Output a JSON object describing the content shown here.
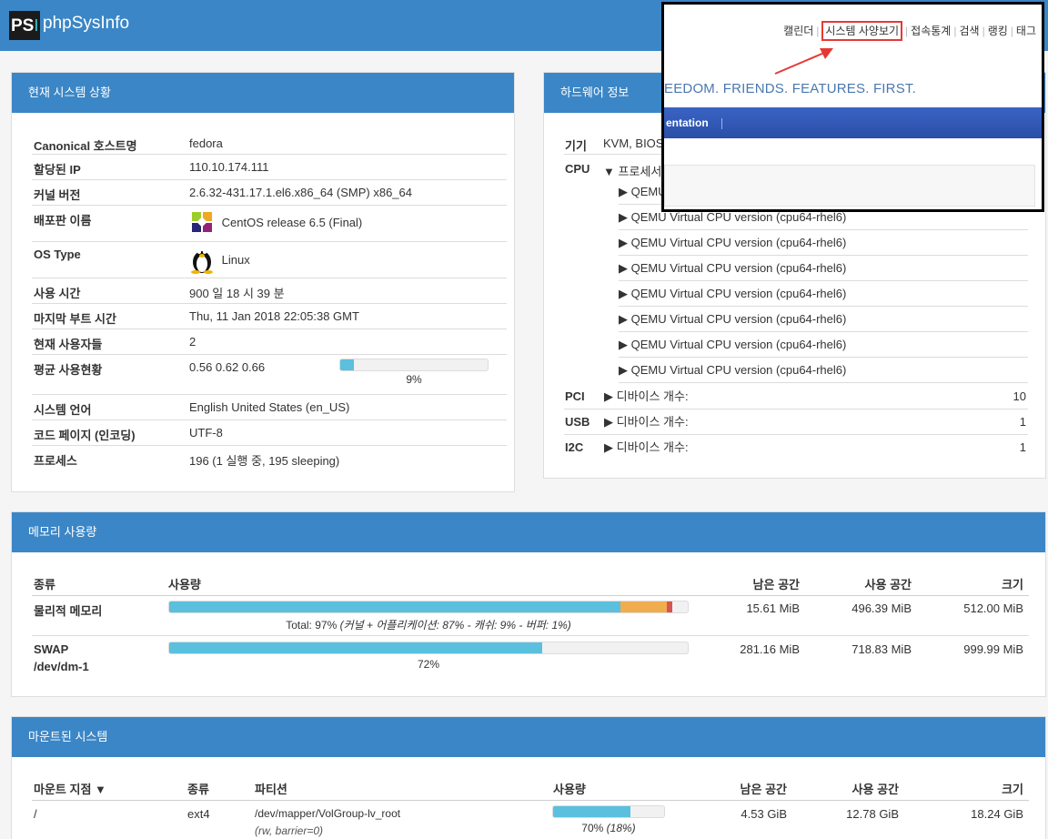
{
  "header": {
    "logo_text": "PS",
    "logo_accent": "I",
    "brand": "phpSysInfo"
  },
  "vitals": {
    "title": "현재 시스템 상황",
    "rows": [
      {
        "label": "Canonical 호스트명",
        "value": "fedora"
      },
      {
        "label": "할당된 IP",
        "value": "110.10.174.111"
      },
      {
        "label": "커널 버전",
        "value": "2.6.32-431.17.1.el6.x86_64 (SMP) x86_64"
      },
      {
        "label": "배포판 이름",
        "value": "CentOS release 6.5 (Final)"
      },
      {
        "label": "OS Type",
        "value": "Linux"
      },
      {
        "label": "사용 시간",
        "value": "900 일 18 시 39 분"
      },
      {
        "label": "마지막 부트 시간",
        "value": "Thu, 11 Jan 2018 22:05:38 GMT"
      },
      {
        "label": "현재 사용자들",
        "value": "2"
      },
      {
        "label": "평균 사용현황",
        "value": "0.56 0.62 0.66"
      },
      {
        "label": "시스템 언어",
        "value": "English United States (en_US)"
      },
      {
        "label": "코드 페이지 (인코딩)",
        "value": "UTF-8"
      },
      {
        "label": "프로세스",
        "value": "196 (1 실행 중, 195 sleeping)"
      }
    ],
    "load_percent": 9,
    "load_percent_label": "9%"
  },
  "hardware": {
    "title": "하드웨어 정보",
    "machine_label": "기기",
    "machine_value": "KVM, BIOS",
    "cpu_label": "CPU",
    "cpu_toggle": "▼ 프로세서",
    "cpu_items": [
      "▶ QEMU Virtual CPU version (cpu64-rhel6)",
      "▶ QEMU Virtual CPU version (cpu64-rhel6)",
      "▶ QEMU Virtual CPU version (cpu64-rhel6)",
      "▶ QEMU Virtual CPU version (cpu64-rhel6)",
      "▶ QEMU Virtual CPU version (cpu64-rhel6)",
      "▶ QEMU Virtual CPU version (cpu64-rhel6)",
      "▶ QEMU Virtual CPU version (cpu64-rhel6)",
      "▶ QEMU Virtual CPU version (cpu64-rhel6)"
    ],
    "buses": [
      {
        "label": "PCI",
        "desc": "▶ 디바이스 개수:",
        "count": "10"
      },
      {
        "label": "USB",
        "desc": "▶ 디바이스 개수:",
        "count": "1"
      },
      {
        "label": "I2C",
        "desc": "▶ 디바이스 개수:",
        "count": "1"
      }
    ]
  },
  "memory": {
    "title": "메모리 사용량",
    "headers": {
      "type": "종류",
      "usage": "사용량",
      "free": "남은 공간",
      "used": "사용 공간",
      "size": "크기"
    },
    "physical": {
      "label": "물리적 메모리",
      "free": "15.61 MiB",
      "used": "496.39 MiB",
      "size": "512.00 MiB",
      "kernel_percent": 87,
      "cache_percent": 9,
      "buffer_percent": 1,
      "total_text": "Total: 97%",
      "detail_text": "(커널 + 어플리케이션: 87% - 캐쉬: 9% - 버퍼: 1%)"
    },
    "swap": {
      "label": "SWAP",
      "device": "/dev/dm-1",
      "free": "281.16 MiB",
      "used": "718.83 MiB",
      "size": "999.99 MiB",
      "percent": 72,
      "percent_label": "72%"
    }
  },
  "filesystems": {
    "title": "마운트된 시스템",
    "headers": {
      "mount": "마운트 지점 ▼",
      "type": "종류",
      "partition": "파티션",
      "usage": "사용량",
      "free": "남은 공간",
      "used": "사용 공간",
      "size": "크기"
    },
    "rows": [
      {
        "mount": "/",
        "type": "ext4",
        "partition": "/dev/mapper/VolGroup-lv_root",
        "options": "(rw, barrier=0)",
        "percent": 70,
        "usage_label": "70%",
        "usage_extra": "(18%)",
        "free": "4.53 GiB",
        "used": "12.78 GiB",
        "size": "18.24 GiB"
      }
    ]
  },
  "overlay": {
    "nav": [
      "캘린더",
      "시스템 사양보기",
      "접속통계",
      "검색",
      "랭킹",
      "태그"
    ],
    "slogan": "EEDOM. FRIENDS. FEATURES. FIRST.",
    "bluebar_text": "entation"
  }
}
